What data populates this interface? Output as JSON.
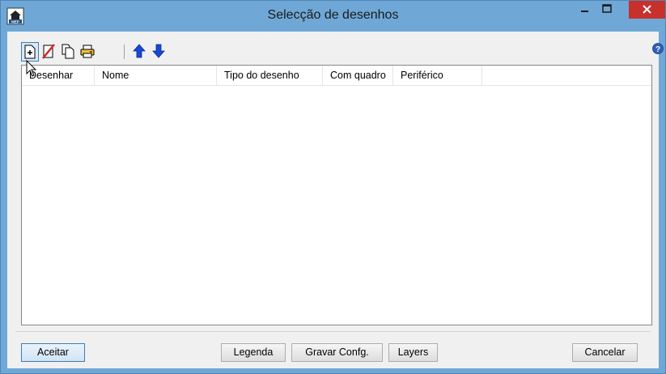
{
  "window": {
    "title": "Selecção de desenhos",
    "minimize_glyph": "–",
    "maximize_glyph": "□",
    "close_glyph": "✕",
    "app_icon": "mep-app-icon"
  },
  "toolbar": {
    "items": [
      {
        "name": "add-drawing",
        "icon": "add-page-icon"
      },
      {
        "name": "delete-drawing",
        "icon": "delete-page-icon"
      },
      {
        "name": "copy-drawing",
        "icon": "copy-pages-icon"
      },
      {
        "name": "print-drawing",
        "icon": "printer-icon"
      },
      {
        "name": "move-up",
        "icon": "arrow-up-icon"
      },
      {
        "name": "move-down",
        "icon": "arrow-down-icon"
      }
    ]
  },
  "list": {
    "columns": [
      "Desenhar",
      "Nome",
      "Tipo do desenho",
      "Com quadro",
      "Periférico"
    ],
    "rows": []
  },
  "buttons": {
    "accept": "Aceitar",
    "legend": "Legenda",
    "save_config": "Gravar Confg.",
    "layers": "Layers",
    "cancel": "Cancelar"
  },
  "colors": {
    "titlebar": "#6fa8d6",
    "close": "#c7302b",
    "arrows": "#1848d8"
  }
}
